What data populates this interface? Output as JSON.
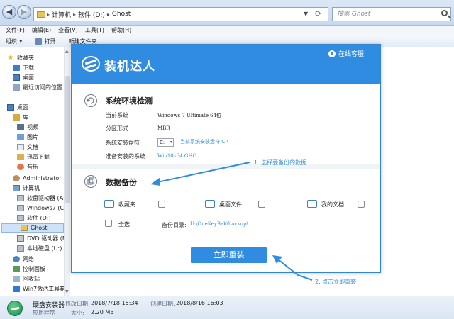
{
  "explorer": {
    "breadcrumb": [
      "计算机",
      "软件 (D:)",
      "Ghost"
    ],
    "search_placeholder": "搜索 Ghost",
    "menu": [
      "文件(F)",
      "编辑(E)",
      "查看(V)",
      "工具(T)",
      "帮助(H)"
    ],
    "commands": {
      "organize": "组织",
      "open": "打开",
      "new_folder": "新建文件夹"
    },
    "sidebar": [
      {
        "label": "收藏夹",
        "icon": "star-icon"
      },
      {
        "label": "下载",
        "icon": "download-folder-icon"
      },
      {
        "label": "桌面",
        "icon": "desktop-icon"
      },
      {
        "label": "最近访问的位置",
        "icon": "recent-places-icon"
      },
      {
        "label": "桌面",
        "icon": "desktop-icon"
      },
      {
        "label": "库",
        "icon": "library-icon"
      },
      {
        "label": "视频",
        "icon": "video-icon"
      },
      {
        "label": "图片",
        "icon": "pictures-icon"
      },
      {
        "label": "文档",
        "icon": "documents-icon"
      },
      {
        "label": "迅雷下载",
        "icon": "thunder-download-icon"
      },
      {
        "label": "音乐",
        "icon": "music-icon"
      },
      {
        "label": "Administrator",
        "icon": "user-icon"
      },
      {
        "label": "计算机",
        "icon": "computer-icon"
      },
      {
        "label": "软盘驱动器 (A:",
        "icon": "floppy-drive-icon"
      },
      {
        "label": "Windows7 (C:",
        "icon": "disk-icon"
      },
      {
        "label": "软件 (D:)",
        "icon": "disk-icon"
      },
      {
        "label": "Ghost",
        "icon": "folder-icon"
      },
      {
        "label": "DVD 驱动器 (F",
        "icon": "dvd-drive-icon"
      },
      {
        "label": "本地磁盘 (U:)",
        "icon": "disk-icon"
      },
      {
        "label": "网络",
        "icon": "network-icon"
      },
      {
        "label": "控制面板",
        "icon": "control-panel-icon"
      },
      {
        "label": "回收站",
        "icon": "recycle-bin-icon"
      },
      {
        "label": "Win7激活工具箱",
        "icon": "app-icon"
      }
    ],
    "status": {
      "file_name": "硬盘安装器",
      "file_type": "应用程序",
      "modified_label": "修改日期:",
      "modified_value": "2018/7/18 15:34",
      "created_label": "创建日期:",
      "created_value": "2018/8/16 16:03",
      "size_label": "大小:",
      "size_value": "2.20 MB"
    }
  },
  "installer": {
    "title": "装机达人",
    "support": "在线客服",
    "env_check": {
      "title": "系统环境检测",
      "current_os_label": "当前系统",
      "current_os_value": "Windows 7 Ultimate 64位",
      "partition_label": "分区形式",
      "partition_value": "MBR",
      "install_disk_label": "系统安装盘符",
      "install_disk_value": "C:",
      "install_disk_hint": "当前系统安装盘符 C:\\",
      "system_to_install_label": "准备安装的系统",
      "system_to_install_value": "Win10x64.GHO"
    },
    "backup": {
      "title": "数据备份",
      "favorites": "收藏夹",
      "desktop_files": "桌面文件",
      "my_documents": "我的文档",
      "select_all": "全选",
      "dir_label": "备份目录:",
      "dir_value": "U:\\OneKeyBak\\backup\\"
    },
    "reinstall_button": "立即重装"
  },
  "annotations": {
    "step1": "1. 选择要备份的数据",
    "step2": "2. 点击立即重装"
  }
}
